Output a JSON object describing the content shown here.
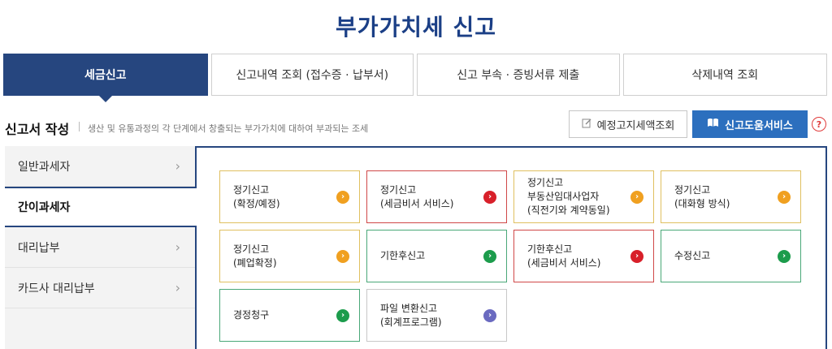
{
  "page_title": "부가가치세 신고",
  "tabs": [
    {
      "label": "세금신고",
      "active": true
    },
    {
      "label": "신고내역 조회 (접수증 · 납부서)",
      "active": false
    },
    {
      "label": "신고 부속 · 증빙서류 제출",
      "active": false
    },
    {
      "label": "삭제내역 조회",
      "active": false
    }
  ],
  "section": {
    "title": "신고서 작성",
    "description": "생산 및 유통과정의 각 단계에서 창출되는 부가가치에 대하여 부과되는 조세"
  },
  "buttons": {
    "notice_query": "예정고지세액조회",
    "help_service": "신고도움서비스",
    "help_icon": "?"
  },
  "sidebar": {
    "items": [
      {
        "label": "일반과세자",
        "active": false
      },
      {
        "label": "간이과세자",
        "active": true
      },
      {
        "label": "대리납부",
        "active": false
      },
      {
        "label": "카드사 대리납부",
        "active": false
      }
    ]
  },
  "cards": [
    {
      "lines": [
        "정기신고",
        "(확정/예정)"
      ],
      "arrow_color": "orange",
      "border_color": "#e0c060"
    },
    {
      "lines": [
        "정기신고",
        "(세금비서 서비스)"
      ],
      "arrow_color": "red",
      "border_color": "#d04848"
    },
    {
      "lines": [
        "정기신고",
        "부동산임대사업자",
        "(직전기와 계약동일)"
      ],
      "arrow_color": "orange",
      "border_color": "#e0c060"
    },
    {
      "lines": [
        "정기신고",
        "(대화형 방식)"
      ],
      "arrow_color": "orange",
      "border_color": "#e0c060"
    },
    {
      "lines": [
        "정기신고",
        "(폐업확정)"
      ],
      "arrow_color": "orange",
      "border_color": "#e0c060"
    },
    {
      "lines": [
        "기한후신고"
      ],
      "arrow_color": "green",
      "border_color": "#4aa878"
    },
    {
      "lines": [
        "기한후신고",
        "(세금비서 서비스)"
      ],
      "arrow_color": "red",
      "border_color": "#d04848"
    },
    {
      "lines": [
        "수정신고"
      ],
      "arrow_color": "green",
      "border_color": "#4aa878"
    },
    {
      "lines": [
        "경정청구"
      ],
      "arrow_color": "green",
      "border_color": "#4aa878"
    },
    {
      "lines": [
        "파일 변환신고",
        "(회계프로그램)"
      ],
      "arrow_color": "purple",
      "border_color": "#c8c8c8"
    }
  ],
  "colors": {
    "brand_navy": "#26467f",
    "title_blue": "#1b3f86",
    "help_button_blue": "#2c6fbe"
  }
}
